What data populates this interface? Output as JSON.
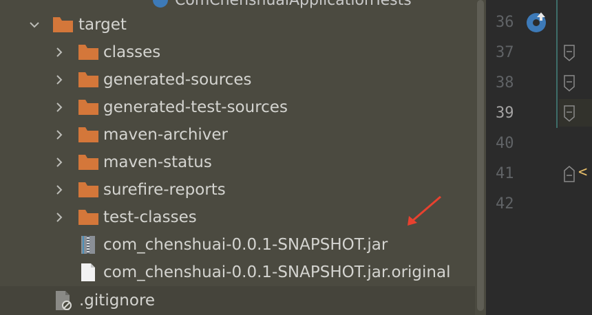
{
  "project_tree": {
    "top_partial_label": "ComChenshuaiApplicationTests",
    "target_folder": {
      "label": "target",
      "expanded": true
    },
    "children": [
      {
        "label": "classes",
        "type": "folder"
      },
      {
        "label": "generated-sources",
        "type": "folder"
      },
      {
        "label": "generated-test-sources",
        "type": "folder"
      },
      {
        "label": "maven-archiver",
        "type": "folder"
      },
      {
        "label": "maven-status",
        "type": "folder"
      },
      {
        "label": "surefire-reports",
        "type": "folder"
      },
      {
        "label": "test-classes",
        "type": "folder"
      }
    ],
    "files": [
      {
        "label": "com_chenshuai-0.0.1-SNAPSHOT.jar",
        "icon": "jar-archive-icon"
      },
      {
        "label": "com_chenshuai-0.0.1-SNAPSHOT.jar.original",
        "icon": "text-file-icon"
      }
    ],
    "gitignore": {
      "label": ".gitignore",
      "icon": "ignored-file-icon"
    }
  },
  "editor": {
    "line_numbers": [
      "36",
      "37",
      "38",
      "39",
      "40",
      "41",
      "42"
    ],
    "current_line": "39",
    "code_fragment": "<"
  },
  "colors": {
    "tree_bg": "#4b4a40",
    "folder": "#d4773a",
    "annotation_arrow": "#e8412f",
    "editor_bg": "#2b2b2b"
  }
}
